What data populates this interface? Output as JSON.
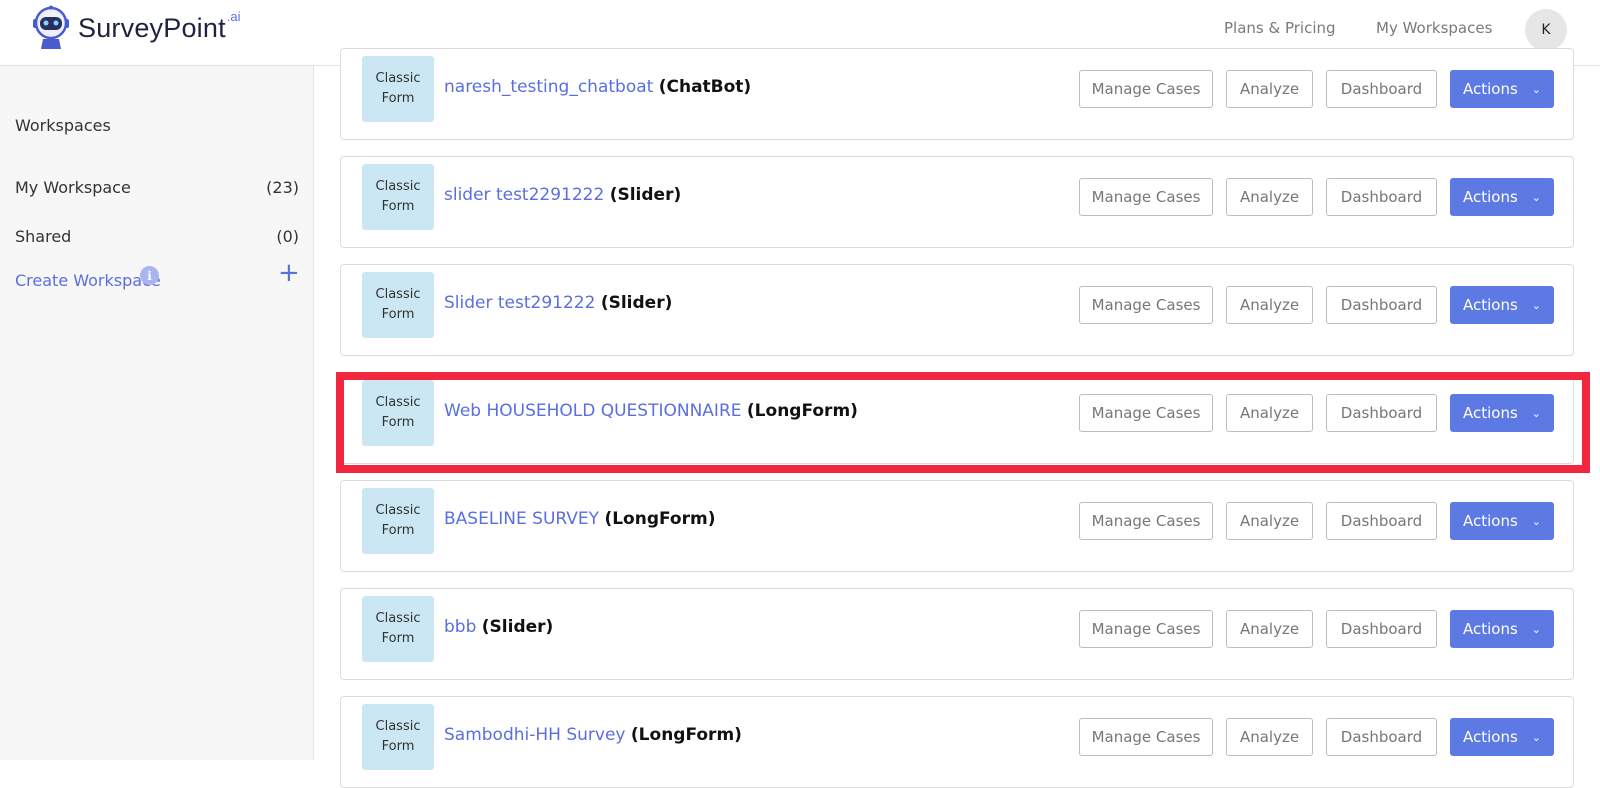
{
  "header": {
    "logo_text": "SurveyPoint",
    "logo_suffix": ".ai",
    "nav": [
      "Plans & Pricing",
      "My Workspaces"
    ],
    "avatar_initial": "K"
  },
  "sidebar": {
    "title": "Workspaces",
    "items": [
      {
        "label": "My Workspace",
        "count": "(23)"
      },
      {
        "label": "Shared",
        "count": "(0)"
      }
    ],
    "create_label": "Create Workspace",
    "info_icon": "i",
    "plus_icon": "+"
  },
  "surveys": [
    {
      "badge1": "Classic",
      "badge2": "Form",
      "name": "naresh_testing_chatboat",
      "type": "(ChatBot)"
    },
    {
      "badge1": "Classic",
      "badge2": "Form",
      "name": "slider test2291222",
      "type": "(Slider)"
    },
    {
      "badge1": "Classic",
      "badge2": "Form",
      "name": "Slider test291222",
      "type": "(Slider)"
    },
    {
      "badge1": "Classic",
      "badge2": "Form",
      "name": "Web HOUSEHOLD QUESTIONNAIRE",
      "type": "(LongForm)"
    },
    {
      "badge1": "Classic",
      "badge2": "Form",
      "name": "BASELINE SURVEY",
      "type": "(LongForm)"
    },
    {
      "badge1": "Classic",
      "badge2": "Form",
      "name": "bbb",
      "type": "(Slider)"
    },
    {
      "badge1": "Classic",
      "badge2": "Form",
      "name": "Sambodhi-HH Survey",
      "type": "(LongForm)"
    }
  ],
  "buttons": {
    "manage": "Manage Cases",
    "analyze": "Analyze",
    "dashboard": "Dashboard",
    "actions": "Actions",
    "chevron": "⌄"
  },
  "colors": {
    "accent": "#5d79e4",
    "link": "#5a6ee0",
    "badge_bg": "#cbe7f3",
    "highlight": "#f2263e"
  }
}
